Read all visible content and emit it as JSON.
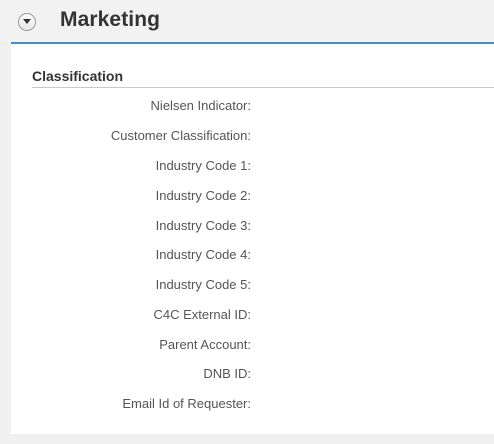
{
  "section": {
    "title": "Marketing",
    "toggle_icon": "chevron-down-icon",
    "accent_color": "#3f8fc9"
  },
  "group": {
    "title": "Classification"
  },
  "fields": [
    {
      "label": "Nielsen Indicator:",
      "value": ""
    },
    {
      "label": "Customer Classification:",
      "value": ""
    },
    {
      "label": "Industry Code 1:",
      "value": ""
    },
    {
      "label": "Industry Code 2:",
      "value": ""
    },
    {
      "label": "Industry Code 3:",
      "value": ""
    },
    {
      "label": "Industry Code 4:",
      "value": ""
    },
    {
      "label": "Industry Code 5:",
      "value": ""
    },
    {
      "label": "C4C External ID:",
      "value": ""
    },
    {
      "label": "Parent Account:",
      "value": ""
    },
    {
      "label": "DNB ID:",
      "value": ""
    },
    {
      "label": "Email Id of Requester:",
      "value": ""
    }
  ]
}
